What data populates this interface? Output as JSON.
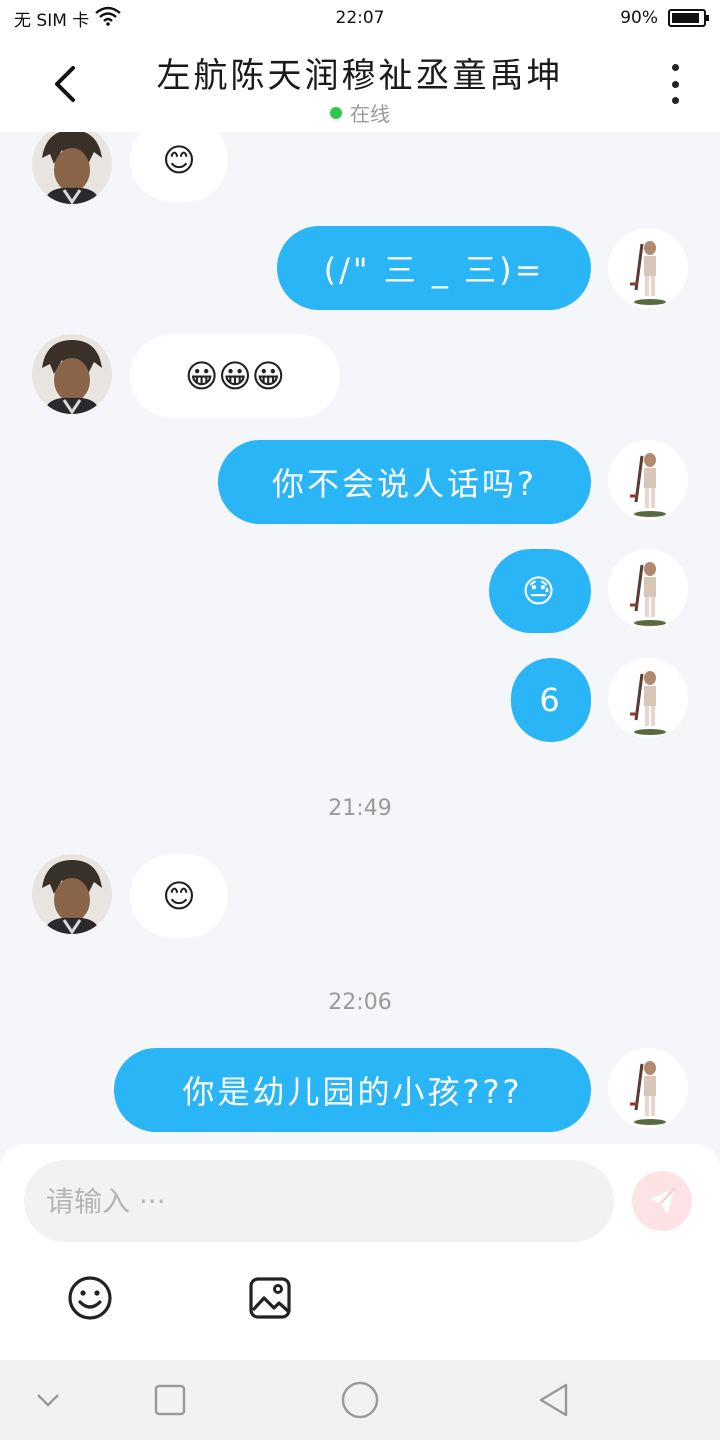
{
  "status_bar": {
    "carrier": "无 SIM 卡",
    "time": "22:07",
    "battery_percent": "90%",
    "battery_level": 0.9
  },
  "header": {
    "title": "左航陈天润穆祉丞童禹坤",
    "status": "在线"
  },
  "messages": [
    {
      "side": "in",
      "type": "emoji",
      "content": "😊"
    },
    {
      "side": "out",
      "type": "text",
      "content": "(/\" 三 _ 三)="
    },
    {
      "side": "in",
      "type": "emoji",
      "content": "😀😀😀"
    },
    {
      "side": "out",
      "type": "text",
      "content": "你不会说人话吗?"
    },
    {
      "side": "out",
      "type": "emoji",
      "content": "😓"
    },
    {
      "side": "out",
      "type": "text",
      "content": "6"
    },
    {
      "side": "time",
      "content": "21:49"
    },
    {
      "side": "in",
      "type": "emoji",
      "content": "😊"
    },
    {
      "side": "time",
      "content": "22:06"
    },
    {
      "side": "out",
      "type": "text",
      "content": "你是幼儿园的小孩???"
    }
  ],
  "composer": {
    "placeholder": "请输入 ···",
    "send_icon": "paper-plane-icon",
    "emoji_icon": "smiley-icon",
    "image_icon": "image-icon"
  },
  "navbar": {
    "icons": [
      "chevron-down-icon",
      "square-icon",
      "circle-icon",
      "triangle-back-icon"
    ]
  },
  "colors": {
    "accent": "#2ab6f6",
    "online": "#2ec74b",
    "background": "#f4f6f9",
    "send_button": "#fde3e3"
  }
}
